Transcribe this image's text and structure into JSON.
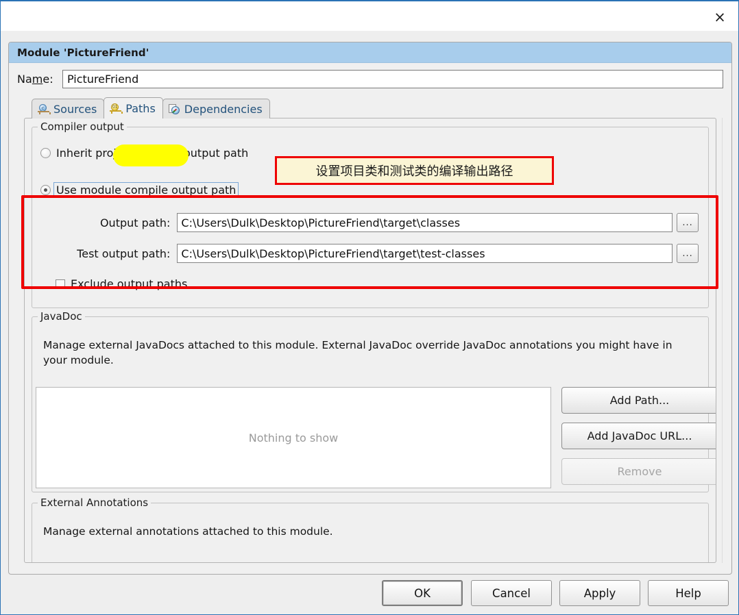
{
  "window": {
    "close_label": "×"
  },
  "dialog": {
    "title": "Module 'PictureFriend'",
    "name_label_pre": "Na",
    "name_label_mnemonic": "m",
    "name_label_post": "e:",
    "name_value": "PictureFriend"
  },
  "tabs": [
    {
      "label": "Sources",
      "icon": "module-sources-icon",
      "active": false
    },
    {
      "label": "Paths",
      "icon": "module-paths-icon",
      "active": true
    },
    {
      "label": "Dependencies",
      "icon": "module-dependencies-icon",
      "active": false
    }
  ],
  "compiler_output": {
    "legend": "Compiler output",
    "inherit_option": "Inherit project compile output path",
    "module_option": "Use module compile output path",
    "output_path_label": "Output path:",
    "output_path_value": "C:\\Users\\Dulk\\Desktop\\PictureFriend\\target\\classes",
    "test_output_path_label": "Test output path:",
    "test_output_path_value": "C:\\Users\\Dulk\\Desktop\\PictureFriend\\target\\test-classes",
    "browse_label": "...",
    "exclude_label": "Exclude output paths",
    "selected_option": "module"
  },
  "javadoc": {
    "legend": "JavaDoc",
    "description": "Manage external JavaDocs attached to this module. External JavaDoc override JavaDoc annotations you might have in your module.",
    "empty_text": "Nothing to show",
    "buttons": [
      {
        "label": "Add Path...",
        "mnemonic": "A",
        "enabled": true
      },
      {
        "label": "Add JavaDoc URL...",
        "mnemonic": "U",
        "enabled": true
      },
      {
        "label": "Remove",
        "mnemonic": "R",
        "enabled": false
      }
    ]
  },
  "external_annotations": {
    "legend": "External Annotations",
    "description": "Manage external annotations attached to this module."
  },
  "footer_buttons": [
    {
      "label": "OK",
      "default": true
    },
    {
      "label": "Cancel",
      "default": false
    },
    {
      "label": "Apply",
      "mnemonic": "A",
      "default": false
    },
    {
      "label": "Help",
      "mnemonic": "H",
      "default": false
    }
  ],
  "annotations": {
    "note_text": "设置项目类和测试类的编译输出路径",
    "note_color": "#ee0000",
    "note_bg": "#fbf5d5",
    "highlight_color": "#ffff00",
    "highlight_target": "Paths"
  },
  "colors": {
    "title_bar": "#a8cdec",
    "window_border": "#2a72b5",
    "dialog_bg": "#f0f0f0",
    "accent_red": "#ee0000"
  }
}
